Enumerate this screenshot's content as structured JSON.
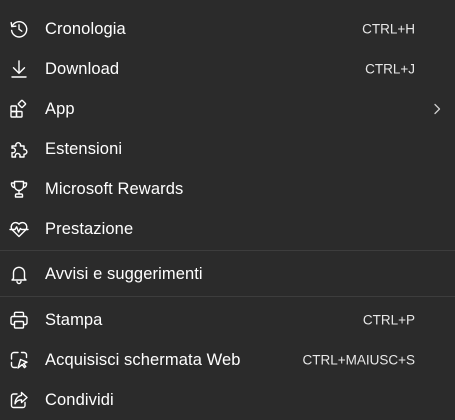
{
  "menu": {
    "items": [
      {
        "id": "history",
        "icon": "history-icon",
        "label": "Cronologia",
        "shortcut": "CTRL+H"
      },
      {
        "id": "downloads",
        "icon": "download-icon",
        "label": "Download",
        "shortcut": "CTRL+J"
      },
      {
        "id": "apps",
        "icon": "apps-icon",
        "label": "App",
        "shortcut": ""
      },
      {
        "id": "extensions",
        "icon": "puzzle-icon",
        "label": "Estensioni",
        "shortcut": ""
      },
      {
        "id": "rewards",
        "icon": "trophy-icon",
        "label": "Microsoft Rewards",
        "shortcut": ""
      },
      {
        "id": "performance",
        "icon": "heart-pulse-icon",
        "label": "Prestazione",
        "shortcut": ""
      },
      {
        "id": "alerts",
        "icon": "bell-icon",
        "label": "Avvisi e suggerimenti",
        "shortcut": ""
      },
      {
        "id": "print",
        "icon": "printer-icon",
        "label": "Stampa",
        "shortcut": "CTRL+P"
      },
      {
        "id": "screenshot",
        "icon": "screenshot-icon",
        "label": "Acquisisci schermata Web",
        "shortcut": "CTRL+MAIUSC+S"
      },
      {
        "id": "share",
        "icon": "share-icon",
        "label": "Condividi",
        "shortcut": ""
      }
    ]
  },
  "colors": {
    "background": "#2b2b2b",
    "text": "#ffffff",
    "separator": "#3d3d3d"
  }
}
